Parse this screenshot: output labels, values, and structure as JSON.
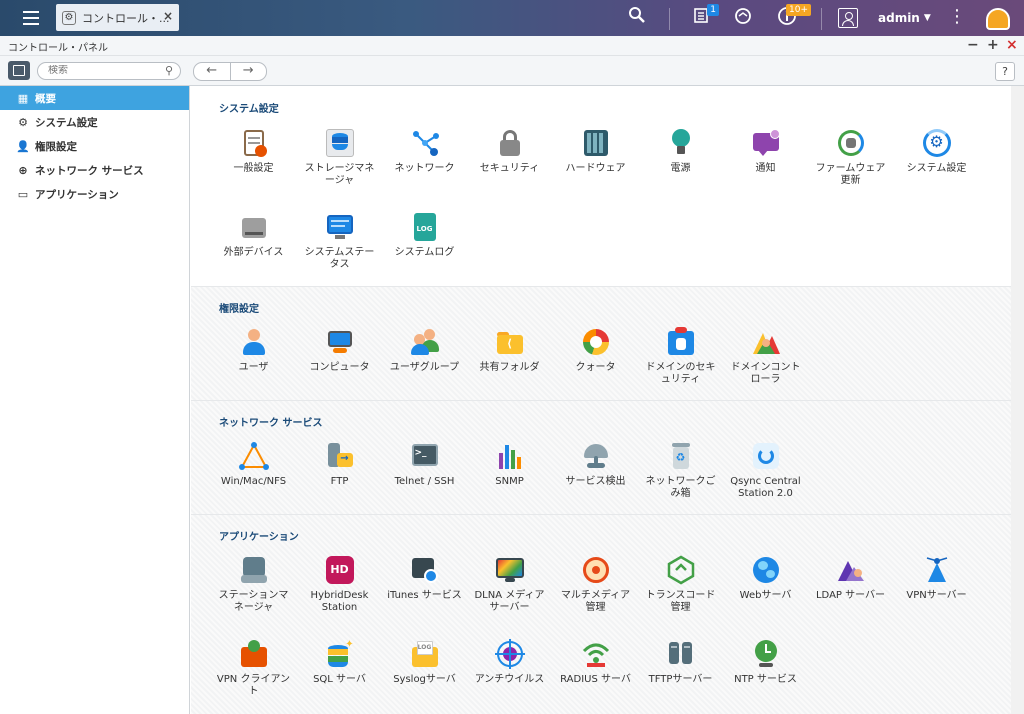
{
  "topbar": {
    "tab_label": "コントロール・...",
    "notification_badge": "1",
    "info_badge": "10+",
    "username": "admin"
  },
  "window": {
    "title": "コントロール・パネル"
  },
  "toolbar": {
    "search_placeholder": "検索",
    "help": "?"
  },
  "sidebar": {
    "items": [
      {
        "label": "概要"
      },
      {
        "label": "システム設定"
      },
      {
        "label": "権限設定"
      },
      {
        "label": "ネットワーク サービス"
      },
      {
        "label": "アプリケーション"
      }
    ]
  },
  "sections": {
    "system": {
      "title": "システム設定",
      "items": [
        {
          "label": "一般設定"
        },
        {
          "label": "ストレージマネ\nージャ"
        },
        {
          "label": "ネットワーク"
        },
        {
          "label": "セキュリティ"
        },
        {
          "label": "ハードウェア"
        },
        {
          "label": "電源"
        },
        {
          "label": "通知"
        },
        {
          "label": "ファームウェア\n更新"
        },
        {
          "label": "システム設定"
        },
        {
          "label": "外部デバイス"
        },
        {
          "label": "システムステー\nタス"
        },
        {
          "label": "システムログ"
        }
      ]
    },
    "privilege": {
      "title": "権限設定",
      "items": [
        {
          "label": "ユーザ"
        },
        {
          "label": "コンピュータ"
        },
        {
          "label": "ユーザグループ"
        },
        {
          "label": "共有フォルダ"
        },
        {
          "label": "クォータ"
        },
        {
          "label": "ドメインのセキ\nュリティ"
        },
        {
          "label": "ドメインコント\nローラ"
        }
      ]
    },
    "network": {
      "title": "ネットワーク サービス",
      "items": [
        {
          "label": "Win/Mac/NFS"
        },
        {
          "label": "FTP"
        },
        {
          "label": "Telnet / SSH"
        },
        {
          "label": "SNMP"
        },
        {
          "label": "サービス検出"
        },
        {
          "label": "ネットワークご\nみ箱"
        },
        {
          "label": "Qsync Central\nStation 2.0"
        }
      ]
    },
    "apps": {
      "title": "アプリケーション",
      "items": [
        {
          "label": "ステーションマ\nネージャ"
        },
        {
          "label": "HybridDesk\nStation"
        },
        {
          "label": "iTunes サービス"
        },
        {
          "label": "DLNA メディア\nサーバー"
        },
        {
          "label": "マルチメディア\n管理"
        },
        {
          "label": "トランスコード\n管理"
        },
        {
          "label": "Webサーバ"
        },
        {
          "label": "LDAP サーバー"
        },
        {
          "label": "VPNサーバー"
        },
        {
          "label": "VPN クライアン\nト"
        },
        {
          "label": "SQL サーバ"
        },
        {
          "label": "Syslogサーバ"
        },
        {
          "label": "アンチウイルス"
        },
        {
          "label": "RADIUS サーバ"
        },
        {
          "label": "TFTPサーバー"
        },
        {
          "label": "NTP サービス"
        }
      ]
    }
  },
  "icon_text": {
    "log": "LOG",
    "hd": "HD",
    "terminal": ">_"
  }
}
